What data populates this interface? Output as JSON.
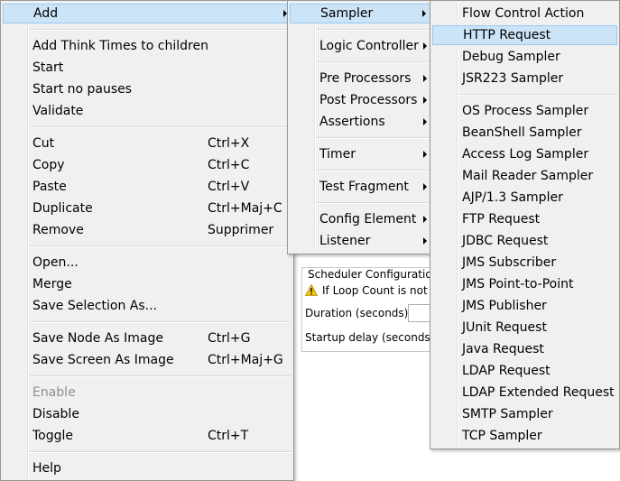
{
  "main_menu": {
    "items": [
      {
        "label": "Add",
        "submenu": true,
        "highlighted": true
      },
      {
        "label": "Add Think Times to children"
      },
      {
        "label": "Start"
      },
      {
        "label": "Start no pauses"
      },
      {
        "label": "Validate"
      },
      {
        "label": "Cut",
        "shortcut": "Ctrl+X"
      },
      {
        "label": "Copy",
        "shortcut": "Ctrl+C"
      },
      {
        "label": "Paste",
        "shortcut": "Ctrl+V"
      },
      {
        "label": "Duplicate",
        "shortcut": "Ctrl+Maj+C"
      },
      {
        "label": "Remove",
        "shortcut": "Supprimer"
      },
      {
        "label": "Open..."
      },
      {
        "label": "Merge"
      },
      {
        "label": "Save Selection As..."
      },
      {
        "label": "Save Node As Image",
        "shortcut": "Ctrl+G"
      },
      {
        "label": "Save Screen As Image",
        "shortcut": "Ctrl+Maj+G"
      },
      {
        "label": "Enable",
        "disabled": true
      },
      {
        "label": "Disable"
      },
      {
        "label": "Toggle",
        "shortcut": "Ctrl+T"
      },
      {
        "label": "Help"
      }
    ]
  },
  "add_submenu": {
    "items": [
      {
        "label": "Sampler",
        "submenu": true,
        "highlighted": true
      },
      {
        "label": "Logic Controller",
        "submenu": true
      },
      {
        "label": "Pre Processors",
        "submenu": true
      },
      {
        "label": "Post Processors",
        "submenu": true
      },
      {
        "label": "Assertions",
        "submenu": true
      },
      {
        "label": "Timer",
        "submenu": true
      },
      {
        "label": "Test Fragment",
        "submenu": true
      },
      {
        "label": "Config Element",
        "submenu": true
      },
      {
        "label": "Listener",
        "submenu": true
      }
    ]
  },
  "sampler_submenu": {
    "items": [
      {
        "label": "Flow Control Action"
      },
      {
        "label": "HTTP Request",
        "highlighted": true
      },
      {
        "label": "Debug Sampler"
      },
      {
        "label": "JSR223 Sampler"
      },
      {
        "label": "OS Process Sampler"
      },
      {
        "label": "BeanShell Sampler"
      },
      {
        "label": "Access Log Sampler"
      },
      {
        "label": "Mail Reader Sampler"
      },
      {
        "label": "AJP/1.3 Sampler"
      },
      {
        "label": "FTP Request"
      },
      {
        "label": "JDBC Request"
      },
      {
        "label": "JMS Subscriber"
      },
      {
        "label": "JMS Point-to-Point"
      },
      {
        "label": "JMS Publisher"
      },
      {
        "label": "JUnit Request"
      },
      {
        "label": "Java Request"
      },
      {
        "label": "LDAP Request"
      },
      {
        "label": "LDAP Extended Request"
      },
      {
        "label": "SMTP Sampler"
      },
      {
        "label": "TCP Sampler"
      }
    ]
  },
  "background": {
    "scheduler_title": "Scheduler Configuration",
    "warning_text": "If Loop Count is not -",
    "duration_label": "Duration (seconds)",
    "startup_delay_label": "Startup delay (seconds)"
  },
  "colors": {
    "menu_bg": "#f0f0f0",
    "highlight_bg": "#cce4f7",
    "highlight_border": "#99c9ef",
    "disabled_text": "#8d8d8d",
    "warning_yellow": "#f5c518"
  }
}
